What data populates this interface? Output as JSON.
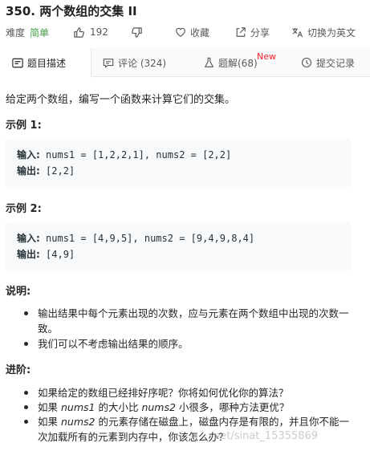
{
  "problem": {
    "title": "350. 两个数组的交集 II",
    "difficulty_label": "难度",
    "difficulty": "简单",
    "likes": "192",
    "favorite_label": "收藏",
    "share_label": "分享",
    "switch_lang_label": "切换为英文"
  },
  "tabs": [
    {
      "label": "题目描述",
      "icon": "document-icon",
      "active": true
    },
    {
      "label": "评论 (324)",
      "icon": "comment-icon"
    },
    {
      "label": "题解(68)",
      "icon": "flask-icon",
      "badge": "New"
    },
    {
      "label": "提交记录",
      "icon": "clock-icon"
    }
  ],
  "description": "给定两个数组，编写一个函数来计算它们的交集。",
  "examples": [
    {
      "heading": "示例 1:",
      "input_label": "输入:",
      "input": " nums1 = [1,2,2,1], nums2 = [2,2]",
      "output_label": "输出:",
      "output": " [2,2]"
    },
    {
      "heading": "示例 2:",
      "input_label": "输入:",
      "input": " nums1 = [4,9,5], nums2 = [9,4,9,8,4]",
      "output_label": "输出:",
      "output": " [4,9]"
    }
  ],
  "notes": {
    "heading": "说明:",
    "items": [
      "输出结果中每个元素出现的次数，应与元素在两个数组中出现的次数一致。",
      "我们可以不考虑输出结果的顺序。"
    ]
  },
  "followup": {
    "heading": "进阶:",
    "item1": "如果给定的数组已经排好序呢？你将如何优化你的算法？",
    "item2_pre": "如果 ",
    "item2_a": "nums1",
    "item2_mid": " 的大小比 ",
    "item2_b": "nums2",
    "item2_post": " 小很多，哪种方法更优？",
    "item3_pre": "如果 ",
    "item3_a": "nums2",
    "item3_post": " 的元素存储在磁盘上，磁盘内存是有限的，并且你不能一次加载所有的元素到内存中，你该怎么办？"
  },
  "watermark": "net/sinat_15355869",
  "colors": {
    "easy": "#43a047",
    "new_badge": "#f5222d",
    "code_bg": "#f7f9fa"
  }
}
